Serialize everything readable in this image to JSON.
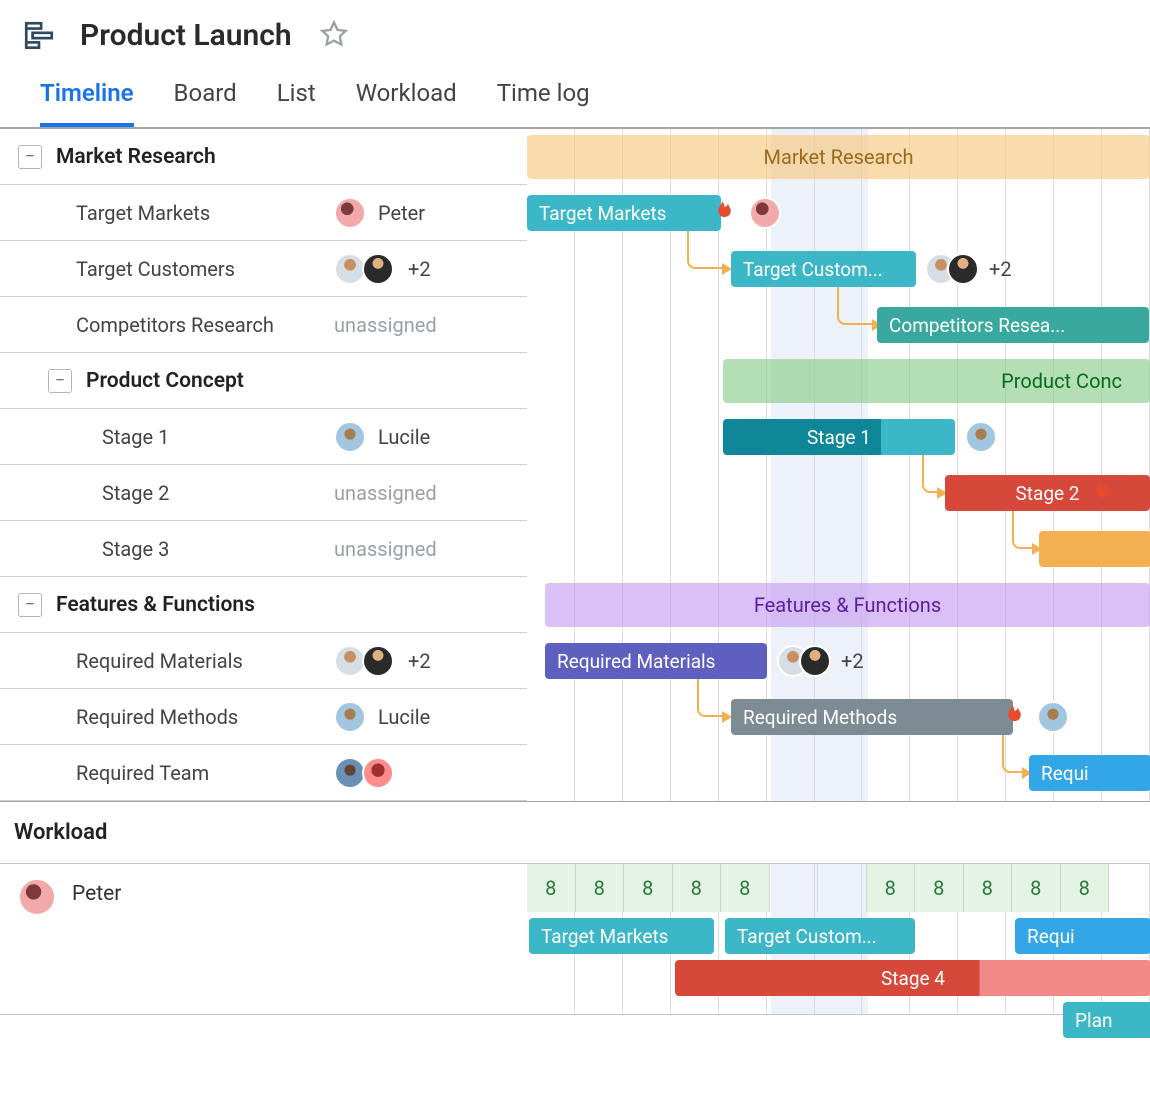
{
  "header": {
    "title": "Product Launch"
  },
  "tabs": {
    "items": [
      "Timeline",
      "Board",
      "List",
      "Workload",
      "Time log"
    ],
    "active": 0
  },
  "groups": [
    {
      "name": "Market Research",
      "bar_label": "Market Research",
      "tasks": [
        {
          "name": "Target Markets",
          "assignee": "Peter",
          "bar_label": "Target Markets"
        },
        {
          "name": "Target Customers",
          "assignee_extra": "+2",
          "bar_label": "Target Custom..."
        },
        {
          "name": "Competitors Research",
          "assignee": "unassigned",
          "bar_label": "Competitors Resea..."
        }
      ]
    },
    {
      "name": "Product Concept",
      "bar_label": "Product Conc",
      "tasks": [
        {
          "name": "Stage 1",
          "assignee": "Lucile",
          "bar_label": "Stage 1"
        },
        {
          "name": "Stage 2",
          "assignee": "unassigned",
          "bar_label": "Stage 2"
        },
        {
          "name": "Stage 3",
          "assignee": "unassigned",
          "bar_label": ""
        }
      ]
    },
    {
      "name": "Features & Functions",
      "bar_label": "Features & Functions",
      "tasks": [
        {
          "name": "Required Materials",
          "assignee_extra": "+2",
          "bar_label": "Required Materials"
        },
        {
          "name": "Required Methods",
          "assignee": "Lucile",
          "bar_label": "Required Methods"
        },
        {
          "name": "Required Team",
          "bar_label": "Requi"
        }
      ]
    }
  ],
  "after_extra": "+2",
  "workload": {
    "title": "Workload",
    "user": {
      "name": "Peter"
    },
    "hours": [
      "8",
      "8",
      "8",
      "8",
      "8",
      "",
      "",
      "8",
      "8",
      "8",
      "8",
      "8"
    ],
    "bars": [
      {
        "label": "Target Markets"
      },
      {
        "label": "Target Custom..."
      },
      {
        "label": "Requi"
      },
      {
        "label": "Stage 4"
      },
      {
        "label": "Plan"
      }
    ]
  }
}
